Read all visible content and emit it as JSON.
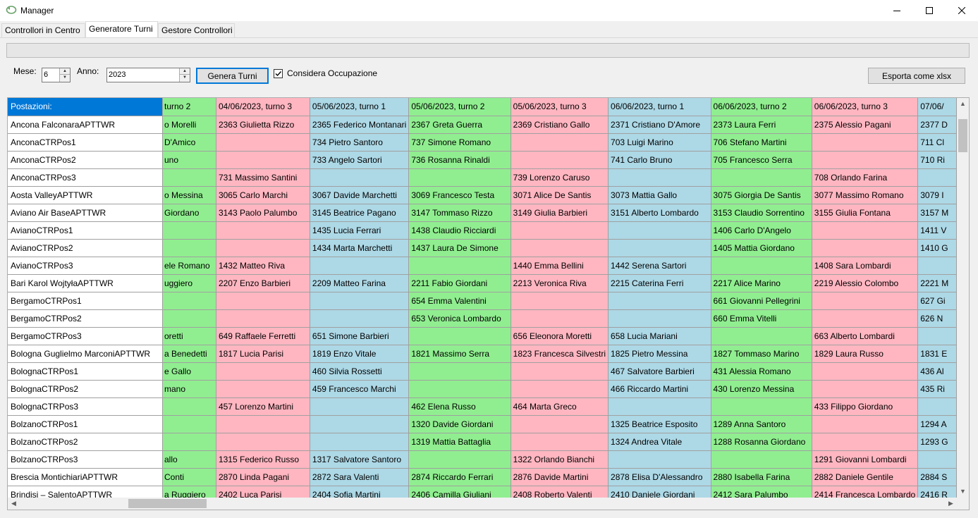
{
  "window": {
    "title": "Manager"
  },
  "tabs": [
    "Controllori in Centro",
    "Generatore Turni",
    "Gestore Controllori"
  ],
  "form": {
    "mese_label": "Mese:",
    "mese_value": "6",
    "anno_label": "Anno:",
    "anno_value": "2023",
    "genera_label": "Genera Turni",
    "considera_label": "Considera Occupazione",
    "considera_checked": true,
    "esporta_label": "Esporta come xlsx"
  },
  "grid": {
    "row_header_title": "Postazioni:",
    "columns": [
      "turno 2",
      "04/06/2023, turno 3",
      "05/06/2023, turno 1",
      "05/06/2023, turno 2",
      "05/06/2023, turno 3",
      "06/06/2023, turno 1",
      "06/06/2023, turno 2",
      "06/06/2023, turno 3",
      "07/06/"
    ],
    "column_colors": [
      "green",
      "pink",
      "blue",
      "green",
      "pink",
      "blue",
      "green",
      "pink",
      "blue"
    ],
    "rows": [
      {
        "name": "Ancona FalconaraAPTTWR",
        "cells": [
          "o Morelli",
          "2363 Giulietta Rizzo",
          "2365 Federico Montanari",
          "2367 Greta Guerra",
          "2369 Cristiano Gallo",
          "2371 Cristiano D'Amore",
          "2373 Laura Ferri",
          "2375 Alessio Pagani",
          "2377 D"
        ]
      },
      {
        "name": "AnconaCTRPos1",
        "cells": [
          "D'Amico",
          "",
          "734 Pietro Santoro",
          "737 Simone Romano",
          "",
          "703 Luigi Marino",
          "706 Stefano Martini",
          "",
          "711 Cl"
        ]
      },
      {
        "name": "AnconaCTRPos2",
        "cells": [
          "uno",
          "",
          "733 Angelo Sartori",
          "736 Rosanna Rinaldi",
          "",
          "741 Carlo Bruno",
          "705 Francesco Serra",
          "",
          "710 Ri"
        ]
      },
      {
        "name": "AnconaCTRPos3",
        "cells": [
          "",
          "731 Massimo Santini",
          "",
          "",
          "739 Lorenzo Caruso",
          "",
          "",
          "708 Orlando Farina",
          ""
        ]
      },
      {
        "name": "Aosta ValleyAPTTWR",
        "cells": [
          "o Messina",
          "3065 Carlo Marchi",
          "3067 Davide Marchetti",
          "3069 Francesco Testa",
          "3071 Alice De Santis",
          "3073 Mattia Gallo",
          "3075 Giorgia De Santis",
          "3077 Massimo Romano",
          "3079 I"
        ]
      },
      {
        "name": "Aviano Air BaseAPTTWR",
        "cells": [
          "Giordano",
          "3143 Paolo Palumbo",
          "3145 Beatrice Pagano",
          "3147 Tommaso Rizzo",
          "3149 Giulia Barbieri",
          "3151 Alberto Lombardo",
          "3153 Claudio Sorrentino",
          "3155 Giulia Fontana",
          "3157 M"
        ]
      },
      {
        "name": "AvianoCTRPos1",
        "cells": [
          "",
          "",
          "1435 Lucia Ferrari",
          "1438 Claudio Ricciardi",
          "",
          "",
          "1406 Carlo D'Angelo",
          "",
          "1411 V"
        ]
      },
      {
        "name": "AvianoCTRPos2",
        "cells": [
          "",
          "",
          "1434 Marta Marchetti",
          "1437 Laura De Simone",
          "",
          "",
          "1405 Mattia Giordano",
          "",
          "1410 G"
        ]
      },
      {
        "name": "AvianoCTRPos3",
        "cells": [
          "ele Romano",
          "1432 Matteo Riva",
          "",
          "",
          "1440 Emma Bellini",
          "1442 Serena Sartori",
          "",
          "1408 Sara Lombardi",
          ""
        ]
      },
      {
        "name": "Bari Karol WojtyłaAPTTWR",
        "cells": [
          "uggiero",
          "2207 Enzo Barbieri",
          "2209 Matteo Farina",
          "2211 Fabio Giordani",
          "2213 Veronica Riva",
          "2215 Caterina Ferri",
          "2217 Alice Marino",
          "2219 Alessio Colombo",
          "2221 M"
        ]
      },
      {
        "name": "BergamoCTRPos1",
        "cells": [
          "",
          "",
          "",
          "654 Emma Valentini",
          "",
          "",
          "661 Giovanni Pellegrini",
          "",
          "627 Gi"
        ]
      },
      {
        "name": "BergamoCTRPos2",
        "cells": [
          "",
          "",
          "",
          "653 Veronica Lombardo",
          "",
          "",
          "660 Emma Vitelli",
          "",
          "626 N"
        ]
      },
      {
        "name": "BergamoCTRPos3",
        "cells": [
          "oretti",
          "649 Raffaele Ferretti",
          "651 Simone Barbieri",
          "",
          "656 Eleonora Moretti",
          "658 Lucia Mariani",
          "",
          "663 Alberto Lombardi",
          ""
        ]
      },
      {
        "name": "Bologna Guglielmo MarconiAPTTWR",
        "cells": [
          "a Benedetti",
          "1817 Lucia Parisi",
          "1819 Enzo Vitale",
          "1821 Massimo Serra",
          "1823 Francesca Silvestri",
          "1825 Pietro Messina",
          "1827 Tommaso Marino",
          "1829 Laura Russo",
          "1831 E"
        ]
      },
      {
        "name": "BolognaCTRPos1",
        "cells": [
          "e Gallo",
          "",
          "460 Silvia Rossetti",
          "",
          "",
          "467 Salvatore Barbieri",
          "431 Alessia Romano",
          "",
          "436 Al"
        ]
      },
      {
        "name": "BolognaCTRPos2",
        "cells": [
          "mano",
          "",
          "459 Francesco Marchi",
          "",
          "",
          "466 Riccardo Martini",
          "430 Lorenzo Messina",
          "",
          "435 Ri"
        ]
      },
      {
        "name": "BolognaCTRPos3",
        "cells": [
          "",
          "457 Lorenzo Martini",
          "",
          "462 Elena Russo",
          "464 Marta Greco",
          "",
          "",
          "433 Filippo Giordano",
          ""
        ]
      },
      {
        "name": "BolzanoCTRPos1",
        "cells": [
          "",
          "",
          "",
          "1320 Davide Giordani",
          "",
          "1325 Beatrice Esposito",
          "1289 Anna Santoro",
          "",
          "1294 A"
        ]
      },
      {
        "name": "BolzanoCTRPos2",
        "cells": [
          "",
          "",
          "",
          "1319 Mattia Battaglia",
          "",
          "1324 Andrea Vitale",
          "1288 Rosanna Giordano",
          "",
          "1293 G"
        ]
      },
      {
        "name": "BolzanoCTRPos3",
        "cells": [
          "allo",
          "1315 Federico Russo",
          "1317 Salvatore Santoro",
          "",
          "1322 Orlando Bianchi",
          "",
          "",
          "1291 Giovanni Lombardi",
          ""
        ]
      },
      {
        "name": "Brescia MontichiariAPTTWR",
        "cells": [
          "Conti",
          "2870 Linda Pagani",
          "2872 Sara Valenti",
          "2874 Riccardo Ferrari",
          "2876 Davide Martini",
          "2878 Elisa D'Alessandro",
          "2880 Isabella Farina",
          "2882 Daniele Gentile",
          "2884 S"
        ]
      },
      {
        "name": "Brindisi – SalentoAPTTWR",
        "cells": [
          "a Ruggiero",
          "2402 Luca Parisi",
          "2404 Sofia Martini",
          "2406 Camilla Giuliani",
          "2408 Roberto Valenti",
          "2410 Daniele Giordani",
          "2412 Sara Palumbo",
          "2414 Francesca Lombardo",
          "2416 R"
        ]
      }
    ]
  }
}
